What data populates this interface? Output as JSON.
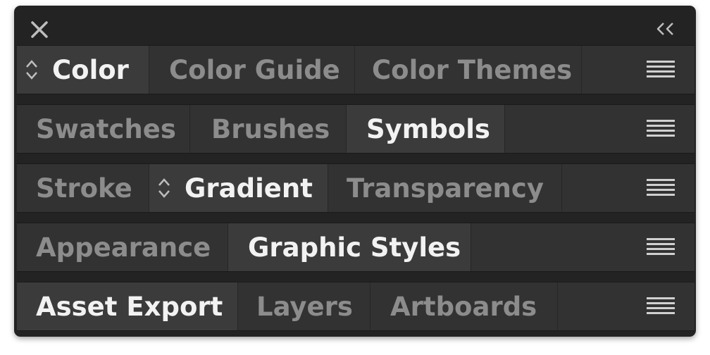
{
  "titlebar": {
    "close_icon": "close-icon",
    "collapse_icon": "double-chevron-left-icon"
  },
  "colors": {
    "panel_bg": "#232323",
    "row_bg": "#323232",
    "active_tab_bg": "#3b3b3b",
    "active_text": "#f2f2f2",
    "inactive_text": "#8c8c8c"
  },
  "rows": [
    {
      "tabs": [
        {
          "label": "Color",
          "active": true,
          "arrows": true
        },
        {
          "label": "Color Guide",
          "active": false
        },
        {
          "label": "Color Themes",
          "active": false
        }
      ],
      "menu_icon": "panel-menu-icon"
    },
    {
      "tabs": [
        {
          "label": "Swatches",
          "active": false
        },
        {
          "label": "Brushes",
          "active": false
        },
        {
          "label": "Symbols",
          "active": true
        }
      ],
      "menu_icon": "panel-menu-icon"
    },
    {
      "tabs": [
        {
          "label": "Stroke",
          "active": false
        },
        {
          "label": "Gradient",
          "active": true,
          "arrows": true
        },
        {
          "label": "Transparency",
          "active": false
        }
      ],
      "menu_icon": "panel-menu-icon"
    },
    {
      "tabs": [
        {
          "label": "Appearance",
          "active": false
        },
        {
          "label": "Graphic Styles",
          "active": true
        }
      ],
      "menu_icon": "panel-menu-icon"
    },
    {
      "tabs": [
        {
          "label": "Asset Export",
          "active": true
        },
        {
          "label": "Layers",
          "active": false
        },
        {
          "label": "Artboards",
          "active": false
        }
      ],
      "menu_icon": "panel-menu-icon"
    }
  ]
}
